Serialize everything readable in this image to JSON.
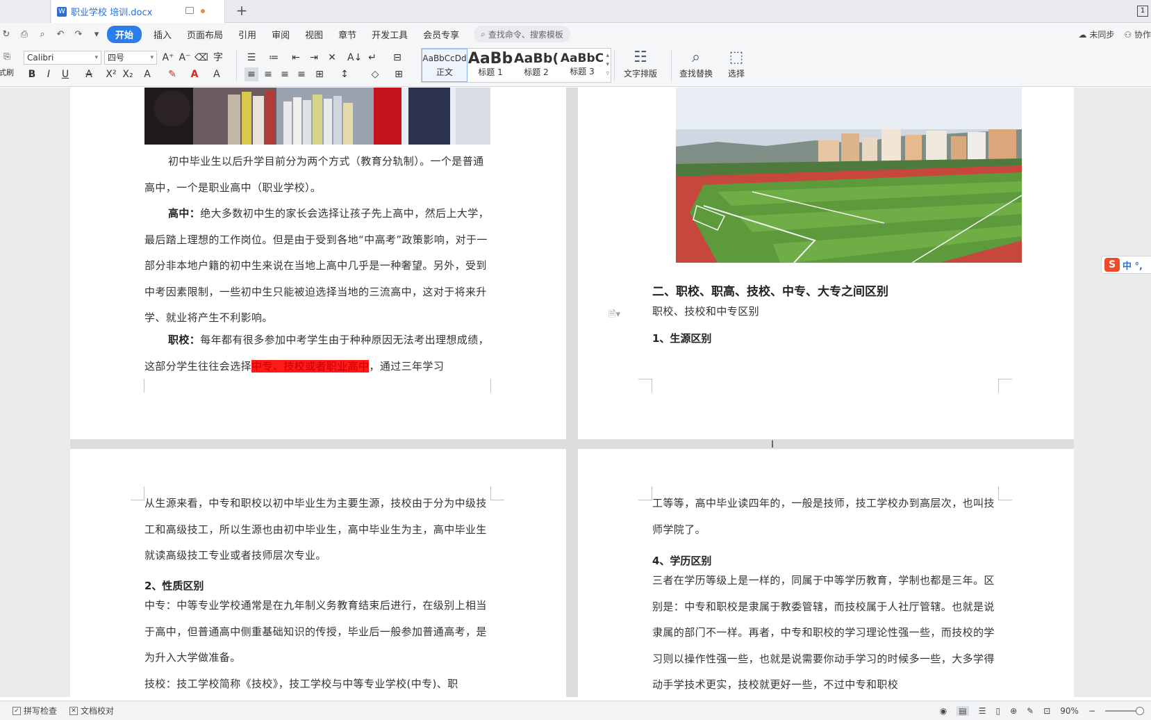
{
  "window": {
    "doc_tab_title": "职业学校 培训.docx",
    "doc_icon_glyph": "W",
    "new_tab_glyph": "+",
    "window_count": "1"
  },
  "menu": {
    "items": [
      "开始",
      "插入",
      "页面布局",
      "引用",
      "审阅",
      "视图",
      "章节",
      "开发工具",
      "会员专享"
    ],
    "search_placeholder": "查找命令、搜索模板",
    "sync_label": "未同步",
    "collab_label": "协作"
  },
  "ribbon": {
    "font_name": "Calibri",
    "font_size": "四号",
    "styles": [
      {
        "sample": "AaBbCcDd",
        "label": "正文"
      },
      {
        "sample": "AaBb",
        "label": "标题 1"
      },
      {
        "sample": "AaBb(",
        "label": "标题 2"
      },
      {
        "sample": "AaBbC",
        "label": "标题 3"
      }
    ],
    "text_layout_label": "文字排版",
    "find_replace_label": "查找替换",
    "select_label": "选择",
    "left_cut_label": "式刷"
  },
  "pages": {
    "p1": {
      "para1": "初中毕业生以后升学目前分为两个方式（教育分轨制）。一个是普通高中，一个是职业高中（职业学校）。",
      "para2_bold": "高中：",
      "para2": "绝大多数初中生的家长会选择让孩子先上高中，然后上大学，最后踏上理想的工作岗位。但是由于受到各地“中高考”政策影响，对于一部分非本地户籍的初中生来说在当地上高中几乎是一种奢望。另外，受到中考因素限制，一些初中生只能被迫选择当地的三流高中，这对于将来升学、就业将产生不利影响。",
      "para3_bold": "职校：",
      "para3_a": "每年都有很多参加中考学生由于种种原因无法考出理想成绩，这部分学生往往会选择",
      "para3_hl": "中专、技校或者职业高中",
      "para3_b": "，通过三年学习"
    },
    "p2": {
      "heading": "二、职校、职高、技校、中专、大专之间区别",
      "subtitle": "职校、技校和中专区别",
      "section1": "1、生源区别"
    },
    "p3": {
      "para1": "从生源来看，中专和职校以初中毕业生为主要生源，技校由于分为中级技工和高级技工，所以生源也由初中毕业生，高中毕业生为主，高中毕业生就读高级技工专业或者技师层次专业。",
      "section2": "2、性质区别",
      "para2": "中专：中等专业学校通常是在九年制义务教育结束后进行，在级别上相当于高中，但普通高中侧重基础知识的传授，毕业后一般参加普通高考，是为升入大学做准备。",
      "para3_partial": "技校：技工学校简称《技校》，技工学校与中等专业学校(中专)、职"
    },
    "p4": {
      "para1": "工等等，高中毕业读四年的，一般是技师，技工学校办到高层次，也叫技师学院了。",
      "section4": "4、学历区别",
      "para2": "三者在学历等级上是一样的，同属于中等学历教育，学制也都是三年。区别是：中专和职校是隶属于教委管辖，而技校属于人社厅管辖。也就是说隶属的部门不一样。再者，中专和职校的学习理论性强一些，而技校的学习则以操作性强一些，也就是说需要你动手学习的时候多一些，大多学得动手学技术更实，技校就更好一些，不过中专和职校"
    }
  },
  "ime": {
    "logo": "S",
    "mode": "中 °,"
  },
  "status": {
    "spell_check": "拼写检查",
    "doc_proof": "文档校对",
    "zoom": "90%"
  },
  "colors": {
    "accent": "#2b7de9",
    "highlight": "#ff1a1a",
    "highlight_text": "#c80000"
  }
}
